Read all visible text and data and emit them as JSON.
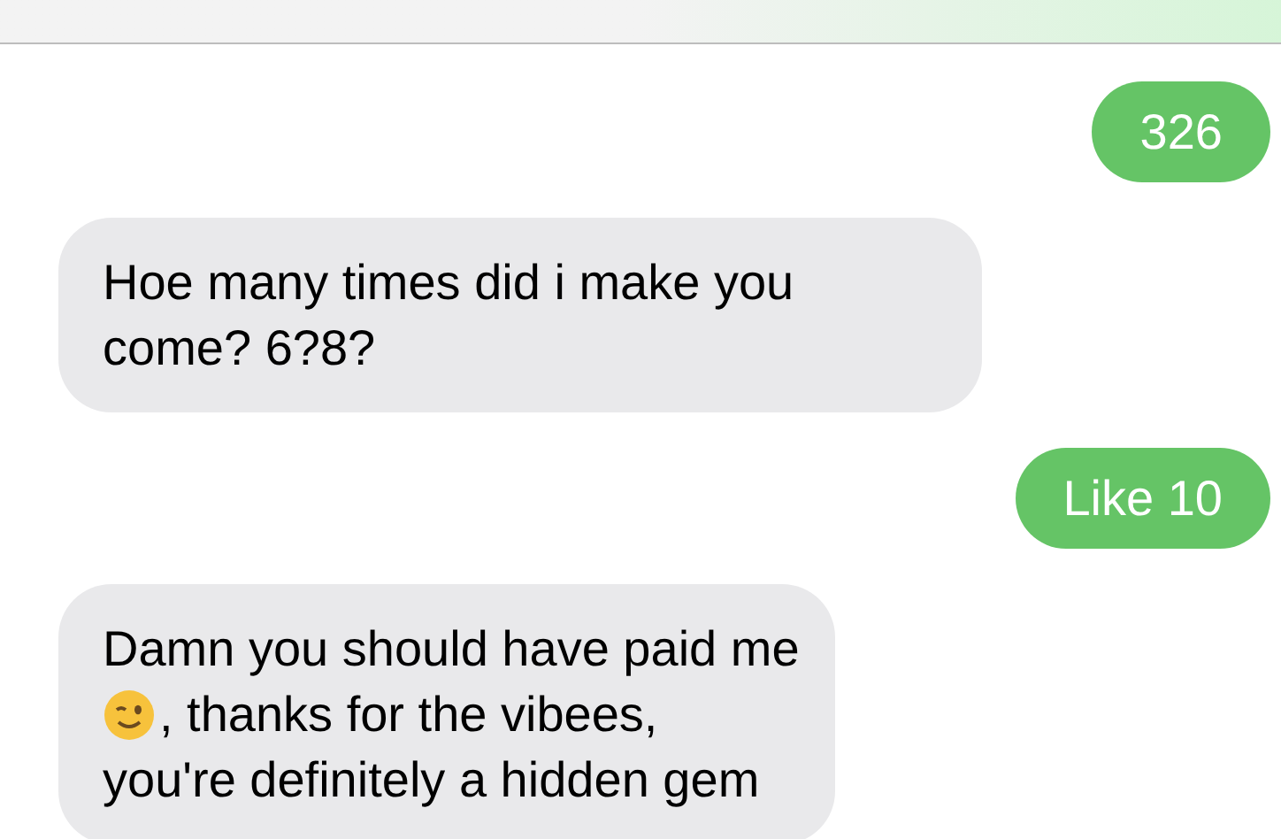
{
  "messages": [
    {
      "kind": "sent",
      "lines": [
        [
          {
            "kind": "text",
            "text": "326"
          }
        ]
      ]
    },
    {
      "kind": "received",
      "lines": [
        [
          {
            "kind": "text",
            "text": "Hoe many times did i make you come? 6?8?"
          }
        ]
      ]
    },
    {
      "kind": "sent",
      "lines": [
        [
          {
            "kind": "text",
            "text": "Like 10"
          }
        ]
      ]
    },
    {
      "kind": "received",
      "lines": [
        [
          {
            "kind": "text",
            "text": "Damn you should have paid me"
          }
        ],
        [
          {
            "kind": "emoji"
          },
          {
            "kind": "text",
            "text": ", thanks for the vibees,"
          }
        ],
        [
          {
            "kind": "text",
            "text": "you're definitely a hidden gem"
          }
        ]
      ]
    }
  ]
}
